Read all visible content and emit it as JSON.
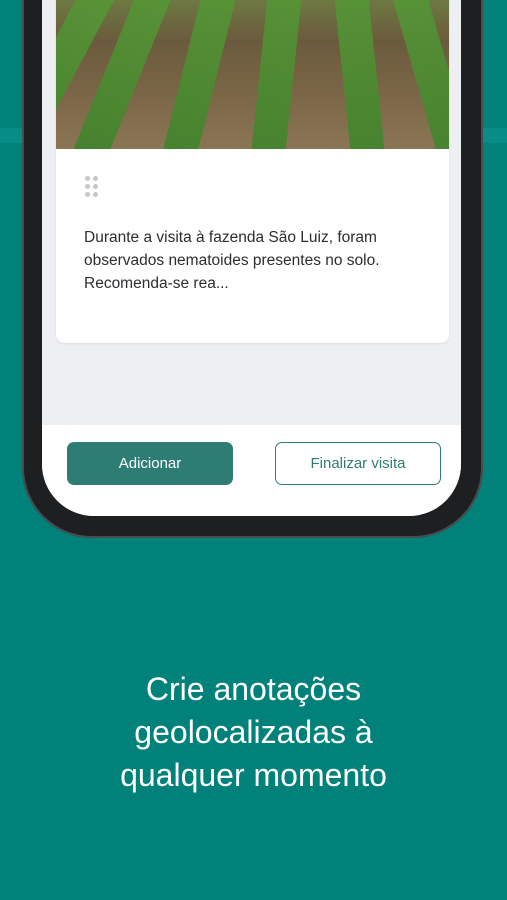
{
  "note": {
    "text": "Durante a visita à fazenda São Luiz, foram observados nematoides presentes no solo. Recomenda-se rea..."
  },
  "actions": {
    "add_label": "Adicionar",
    "finish_label": "Finalizar visita"
  },
  "promo": {
    "line1": "Crie anotações",
    "line2": "geolocalizadas à",
    "line3": "qualquer momento"
  },
  "colors": {
    "background": "#00827a",
    "primary": "#2e7d74",
    "screen": "#eeeff2"
  }
}
